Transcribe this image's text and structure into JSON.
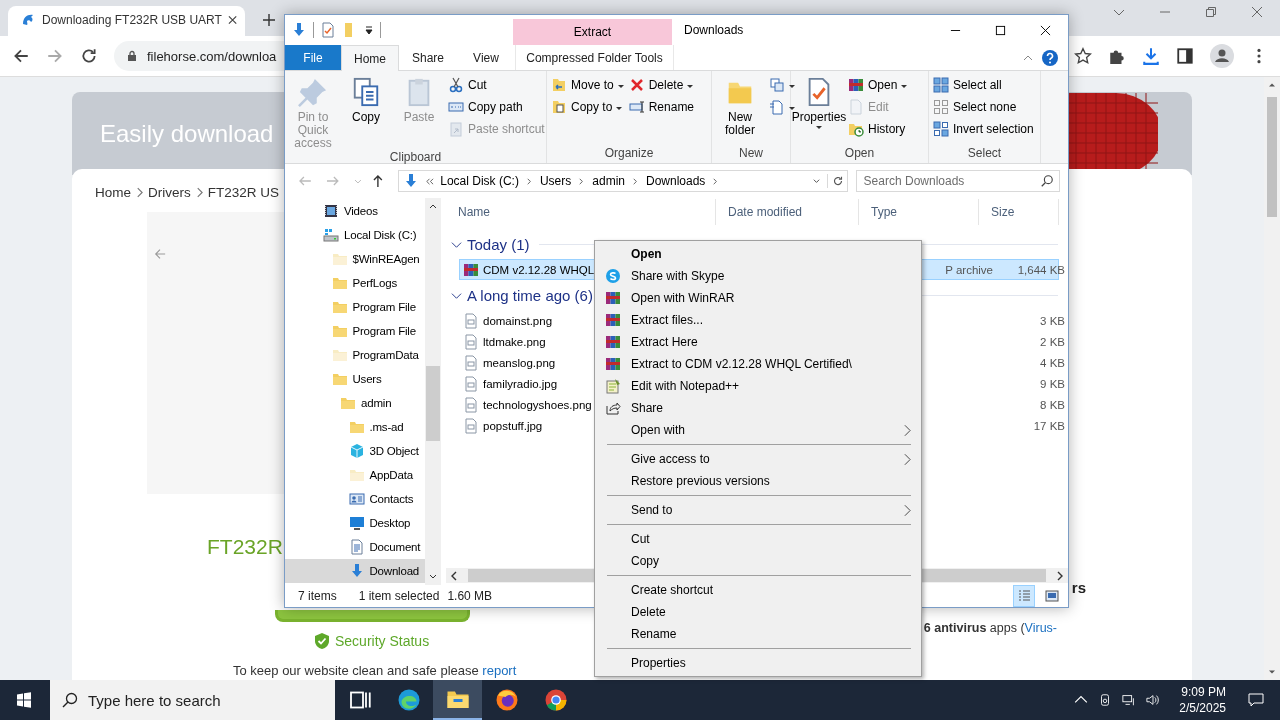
{
  "browser": {
    "tab": {
      "title": "Downloading FT232R USB UART"
    },
    "url": "filehorse.com/downloa",
    "page": {
      "banner": "Easily download",
      "breadcrumb": [
        "Home",
        "Drivers",
        "FT232R US"
      ],
      "heading": "FT232R",
      "security": "Security Status",
      "footer": {
        "text": "To keep our website clean and safe please",
        "link": "report"
      },
      "side_heading": "rs",
      "antivirus": {
        "text": "**6 antivirus** apps (",
        "link": "Virus-"
      }
    }
  },
  "explorer": {
    "title": "Downloads",
    "context_header": "Extract",
    "tabs": [
      {
        "label": "File",
        "kind": "file",
        "selected": false
      },
      {
        "label": "Home",
        "kind": "tab",
        "selected": true
      },
      {
        "label": "Share",
        "kind": "tab",
        "selected": false
      },
      {
        "label": "View",
        "kind": "tab",
        "selected": false
      },
      {
        "label": "Compressed Folder Tools",
        "kind": "context",
        "selected": false
      }
    ],
    "ribbon": [
      {
        "label": "Clipboard",
        "columns": [
          [
            {
              "kind": "large",
              "label": "Pin to Quick access",
              "disabled": true,
              "dropdown": false
            }
          ],
          [
            {
              "kind": "large",
              "label": "Copy",
              "disabled": false,
              "dropdown": false
            }
          ],
          [
            {
              "kind": "large",
              "label": "Paste",
              "disabled": true,
              "dropdown": false
            }
          ],
          [
            {
              "kind": "small",
              "label": "Cut",
              "disabled": false,
              "dropdown": false
            },
            {
              "kind": "small",
              "label": "Copy path",
              "disabled": false,
              "dropdown": false
            },
            {
              "kind": "small",
              "label": "Paste shortcut",
              "disabled": true,
              "dropdown": false
            }
          ]
        ]
      },
      {
        "label": "Organize",
        "columns": [
          [
            {
              "kind": "small",
              "label": "Move to",
              "disabled": false,
              "dropdown": true
            },
            {
              "kind": "small",
              "label": "Copy to",
              "disabled": false,
              "dropdown": true
            }
          ],
          [
            {
              "kind": "small",
              "label": "Delete",
              "disabled": false,
              "dropdown": true
            },
            {
              "kind": "small",
              "label": "Rename",
              "disabled": false,
              "dropdown": false
            }
          ]
        ]
      },
      {
        "label": "New",
        "columns": [
          [
            {
              "kind": "large",
              "label": "New folder",
              "disabled": false,
              "dropdown": false
            }
          ],
          [
            {
              "kind": "small",
              "disabled": false,
              "dropdown": true
            },
            {
              "kind": "small",
              "disabled": false,
              "dropdown": true
            }
          ]
        ]
      },
      {
        "label": "Open",
        "columns": [
          [
            {
              "kind": "large",
              "label": "Properties",
              "disabled": false,
              "dropdown": true
            }
          ],
          [
            {
              "kind": "small",
              "label": "Open",
              "disabled": false,
              "dropdown": true
            },
            {
              "kind": "small",
              "label": "Edit",
              "disabled": true,
              "dropdown": false
            },
            {
              "kind": "small",
              "label": "History",
              "disabled": false,
              "dropdown": false
            }
          ]
        ]
      },
      {
        "label": "Select",
        "columns": [
          [
            {
              "kind": "small",
              "label": "Select all",
              "disabled": false,
              "dropdown": false
            },
            {
              "kind": "small",
              "label": "Select none",
              "disabled": false,
              "dropdown": false
            },
            {
              "kind": "small",
              "label": "Invert selection",
              "disabled": false,
              "dropdown": false
            }
          ]
        ]
      }
    ],
    "address": [
      "Local Disk (C:)",
      "Users",
      "admin",
      "Downloads"
    ],
    "search": {
      "placeholder": "Search Downloads"
    },
    "nav": [
      {
        "label": "Videos",
        "kind": "videos",
        "selected": false
      },
      {
        "label": "Local Disk (C:)",
        "kind": "drive",
        "selected": false,
        "children": [
          {
            "label": "$WinREAgen",
            "kind": "hidden",
            "selected": false
          },
          {
            "label": "PerfLogs",
            "kind": "folder",
            "selected": false
          },
          {
            "label": "Program File",
            "kind": "folder",
            "selected": false
          },
          {
            "label": "Program File",
            "kind": "folder",
            "selected": false
          },
          {
            "label": "ProgramData",
            "kind": "hidden",
            "selected": false
          },
          {
            "label": "Users",
            "kind": "folder",
            "selected": false,
            "children": [
              {
                "label": "admin",
                "kind": "folder",
                "selected": false,
                "children": [
                  {
                    "label": ".ms-ad",
                    "kind": "folder",
                    "selected": false
                  },
                  {
                    "label": "3D Object",
                    "kind": "cube",
                    "selected": false
                  },
                  {
                    "label": "AppData",
                    "kind": "hidden",
                    "selected": false
                  },
                  {
                    "label": "Contacts",
                    "kind": "contacts",
                    "selected": false
                  },
                  {
                    "label": "Desktop",
                    "kind": "desktop",
                    "selected": false
                  },
                  {
                    "label": "Document",
                    "kind": "documents",
                    "selected": false
                  },
                  {
                    "label": "Download",
                    "kind": "downloads",
                    "selected": true
                  }
                ]
              }
            ]
          }
        ]
      }
    ],
    "columns": [
      "Name",
      "Date modified",
      "Type",
      "Size"
    ],
    "groups": [
      {
        "label": "Today (1)",
        "expanded": true,
        "files": [
          {
            "name": "CDM v2.12.28 WHQL",
            "kind": "archive",
            "type": "P archive",
            "size": "1,644 KB",
            "selected": true
          }
        ]
      },
      {
        "label": "A long time ago (6)",
        "expanded": true,
        "files": [
          {
            "name": "domainst.png",
            "kind": "image",
            "size": "3 KB",
            "selected": false
          },
          {
            "name": "ltdmake.png",
            "kind": "image",
            "size": "2 KB",
            "selected": false
          },
          {
            "name": "meanslog.png",
            "kind": "image",
            "size": "4 KB",
            "selected": false
          },
          {
            "name": "familyradio.jpg",
            "kind": "image",
            "size": "9 KB",
            "selected": false
          },
          {
            "name": "technologyshoes.png",
            "kind": "image",
            "size": "8 KB",
            "selected": false
          },
          {
            "name": "popstuff.jpg",
            "kind": "image",
            "size": "17 KB",
            "selected": false
          }
        ]
      }
    ],
    "status": {
      "count": "7 items",
      "selection": "1 item selected",
      "size": "1.60 MB"
    }
  },
  "context_menu": [
    {
      "kind": "plain",
      "label": "Open",
      "default": true,
      "submenu": false
    },
    {
      "kind": "skype",
      "label": "Share with Skype",
      "default": false,
      "submenu": false
    },
    {
      "kind": "winrar",
      "label": "Open with WinRAR",
      "default": false,
      "submenu": false
    },
    {
      "kind": "winrar",
      "label": "Extract files...",
      "default": false,
      "submenu": false
    },
    {
      "kind": "winrar",
      "label": "Extract Here",
      "default": false,
      "submenu": false
    },
    {
      "kind": "winrar",
      "label": "Extract to CDM v2.12.28 WHQL Certified\\",
      "default": false,
      "submenu": false
    },
    {
      "kind": "notepad",
      "label": "Edit with Notepad++",
      "default": false,
      "submenu": false
    },
    {
      "kind": "share",
      "label": "Share",
      "default": false,
      "submenu": false
    },
    {
      "kind": "plain",
      "label": "Open with",
      "default": false,
      "submenu": true
    },
    {
      "kind": "separator"
    },
    {
      "kind": "plain",
      "label": "Give access to",
      "default": false,
      "submenu": true
    },
    {
      "kind": "plain",
      "label": "Restore previous versions",
      "default": false,
      "submenu": false
    },
    {
      "kind": "separator"
    },
    {
      "kind": "plain",
      "label": "Send to",
      "default": false,
      "submenu": true
    },
    {
      "kind": "separator"
    },
    {
      "kind": "plain",
      "label": "Cut",
      "default": false,
      "submenu": false
    },
    {
      "kind": "plain",
      "label": "Copy",
      "default": false,
      "submenu": false
    },
    {
      "kind": "separator"
    },
    {
      "kind": "plain",
      "label": "Create shortcut",
      "default": false,
      "submenu": false
    },
    {
      "kind": "plain",
      "label": "Delete",
      "default": false,
      "submenu": false
    },
    {
      "kind": "plain",
      "label": "Rename",
      "default": false,
      "submenu": false
    },
    {
      "kind": "separator"
    },
    {
      "kind": "plain",
      "label": "Properties",
      "default": false,
      "submenu": false
    }
  ],
  "taskbar": {
    "search": {
      "placeholder": "Type here to search"
    },
    "apps": [
      {
        "kind": "taskview",
        "selected": false
      },
      {
        "kind": "edge",
        "selected": false
      },
      {
        "kind": "explorer",
        "selected": true
      },
      {
        "kind": "firefox",
        "selected": false
      },
      {
        "kind": "chrome",
        "selected": false
      }
    ],
    "time": "9:09 PM",
    "date": "2/5/2025"
  }
}
